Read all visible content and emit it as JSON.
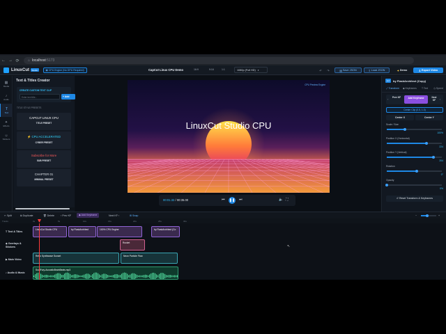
{
  "browser": {
    "url_host": "localhost",
    "url_port": ":5173",
    "nav_back": "←",
    "nav_forward": "→",
    "nav_reload": "⟳",
    "tab_strip_icon": "⌂"
  },
  "header": {
    "app_name": "LinuxCut",
    "app_badge": "Studio",
    "engine_chip": "CPU Engine (No GPU Required)",
    "project_title": "CapCut Linux CPU Demo",
    "aspect": "16:9",
    "aspect_alt": "9:16",
    "aspect_square": "1:1",
    "resolution": "1080p (Full HD)",
    "save_json": "Save JSON",
    "load_json": "Load JSON",
    "demo": "Demo",
    "export": "Export Video"
  },
  "rail": {
    "items": [
      {
        "icon": "▦",
        "label": "Media"
      },
      {
        "icon": "♪",
        "label": "Audio"
      },
      {
        "icon": "T",
        "label": "Text"
      },
      {
        "icon": "✦",
        "label": "Effects"
      },
      {
        "icon": "☺",
        "label": "Stickers"
      }
    ]
  },
  "text_panel": {
    "title": "Text & Titles Creator",
    "custom_label": "CREATE CUSTOM TEXT CLIP",
    "input_placeholder": "Enter text title...",
    "add_button": "+ Add",
    "style_presets_label": "TITLE STYLE PRESETS",
    "presets": [
      {
        "preview": "CAPCUT LINUX CPU",
        "name": "TITLE PRESET",
        "color": "#ffffff"
      },
      {
        "preview": "⚡ CPU ACCELERATED",
        "name": "CYBER PRESET",
        "color": "#33d6ff"
      },
      {
        "preview": "Subscribe for More",
        "name": "SUB PRESET",
        "color": "#ff5a5a"
      },
      {
        "preview": "CHAPTER 01",
        "name": "MINIMAL PRESET",
        "color": "#dfe4ea"
      }
    ]
  },
  "preview": {
    "title": "LinuxCut Studio CPU",
    "engine_tag": "CPU Preview Engine",
    "time_current": "00:01.32",
    "time_sep": "/",
    "time_total": "00:35.00"
  },
  "inspector": {
    "layer_tag": "text",
    "layer_name": "by FlaskArchitect (Copy)",
    "tabs": [
      "Transform",
      "Keyframes",
      "Text",
      "Speed"
    ],
    "prev_kf": "Prev KF",
    "add_keyframe": "Add Keyframe",
    "next_kf": "Next KF",
    "center_clip": "Center Clip (0.5, 1.0)",
    "center_x": "Center X",
    "center_y": "Center Y",
    "sliders": [
      {
        "label": "Scale / Size",
        "value": "100%",
        "fraction": 0.33
      },
      {
        "label": "Position X (Horizontal)",
        "value": "224",
        "fraction": 0.72
      },
      {
        "label": "Position Y (Vertical)",
        "value": "204",
        "fraction": 0.85
      },
      {
        "label": "Rotation",
        "value": "0°",
        "fraction": 0.55
      },
      {
        "label": "Opacity",
        "value": "0%",
        "fraction": 0.0
      }
    ],
    "reset": "Reset Transform & Keyframes"
  },
  "timeline": {
    "toolbar": {
      "split": "Split",
      "duplicate": "Duplicate",
      "delete": "Delete",
      "prev_kf": "Prev KF",
      "add_keyframe": "Add Keyframe",
      "next_kf": "Next KF",
      "snap": "Snap"
    },
    "ruler_label": "Tracks",
    "ruler_ticks": [
      "0s",
      "5s",
      "10s",
      "15s",
      "20s",
      "25s",
      "30s"
    ],
    "tracks": [
      {
        "label": "Text & Titles"
      },
      {
        "label": "Overlays & Stickers"
      },
      {
        "label": "Main Video"
      },
      {
        "label": "Audio & Music"
      }
    ],
    "clips": {
      "t1": "LinuxCut Studio CPU",
      "t2": "by FlaskArchitect",
      "t3": "100% CPU Engine",
      "t4": "by FlaskArchitect (Co",
      "o1": "Rocket",
      "v1": "Retro Synthwave Sunset",
      "v2": "Neon Particle Flow",
      "a1": "SoulFury-AcousticBrainBeats.mp3"
    }
  }
}
